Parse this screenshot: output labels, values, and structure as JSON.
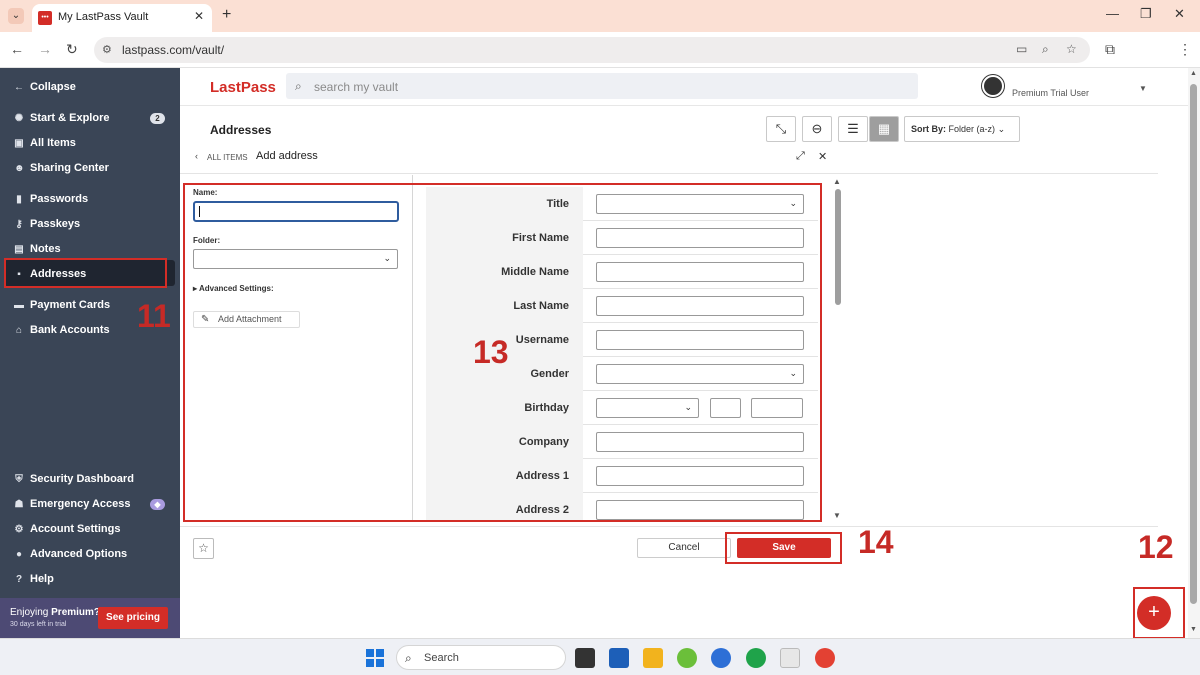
{
  "browser": {
    "tab_title": "My LastPass Vault",
    "tab_close": "✕",
    "tab_new": "+",
    "url": "lastpass.com/vault/",
    "win_minimize": "—",
    "win_restore": "❐",
    "win_close": "✕"
  },
  "sidebar": {
    "collapse": "Collapse",
    "items": [
      {
        "label": "Start & Explore",
        "icon": "compass-icon",
        "badge": "2"
      },
      {
        "label": "All Items",
        "icon": "grid-icon"
      },
      {
        "label": "Sharing Center",
        "icon": "people-icon"
      },
      {
        "label": "Passwords",
        "icon": "lock-icon"
      },
      {
        "label": "Passkeys",
        "icon": "passkey-icon"
      },
      {
        "label": "Notes",
        "icon": "note-icon"
      },
      {
        "label": "Addresses",
        "icon": "address-icon"
      },
      {
        "label": "Payment Cards",
        "icon": "card-icon"
      },
      {
        "label": "Bank Accounts",
        "icon": "bank-icon"
      }
    ],
    "bottom_items": [
      {
        "label": "Security Dashboard",
        "icon": "shield-icon"
      },
      {
        "label": "Emergency Access",
        "icon": "emergency-icon"
      },
      {
        "label": "Account Settings",
        "icon": "gear-icon"
      },
      {
        "label": "Advanced Options",
        "icon": "more-icon"
      },
      {
        "label": "Help",
        "icon": "help-icon"
      }
    ],
    "promo": {
      "line1_prefix": "Enjoying ",
      "line1_bold": "Premium?",
      "line2": "30 days left in trial",
      "button": "See pricing"
    }
  },
  "header": {
    "logo": "LastPass",
    "search_placeholder": "search my vault",
    "user_label": "Premium Trial User"
  },
  "toolbar": {
    "page_title": "Addresses",
    "sort_prefix": "Sort By:",
    "sort_value": "Folder (a-z)"
  },
  "dialog": {
    "crumb_all": "ALL ITEMS",
    "title": "Add address",
    "name_label": "Name:",
    "folder_label": "Folder:",
    "advanced_label": "Advanced Settings:",
    "attach_label": "Add Attachment",
    "fields": [
      {
        "label": "Title",
        "type": "select"
      },
      {
        "label": "First Name",
        "type": "text"
      },
      {
        "label": "Middle Name",
        "type": "text"
      },
      {
        "label": "Last Name",
        "type": "text"
      },
      {
        "label": "Username",
        "type": "text"
      },
      {
        "label": "Gender",
        "type": "select"
      },
      {
        "label": "Birthday",
        "type": "date"
      },
      {
        "label": "Company",
        "type": "text"
      },
      {
        "label": "Address 1",
        "type": "text"
      },
      {
        "label": "Address 2",
        "type": "text"
      }
    ],
    "cancel": "Cancel",
    "save": "Save"
  },
  "annotations": {
    "a11": "11",
    "a12": "12",
    "a13": "13",
    "a14": "14"
  },
  "taskbar": {
    "search": "Search"
  },
  "colors": {
    "brand": "#d32d27",
    "sidebar_bg": "#3a4556",
    "promo_bg": "#4d4a74"
  }
}
